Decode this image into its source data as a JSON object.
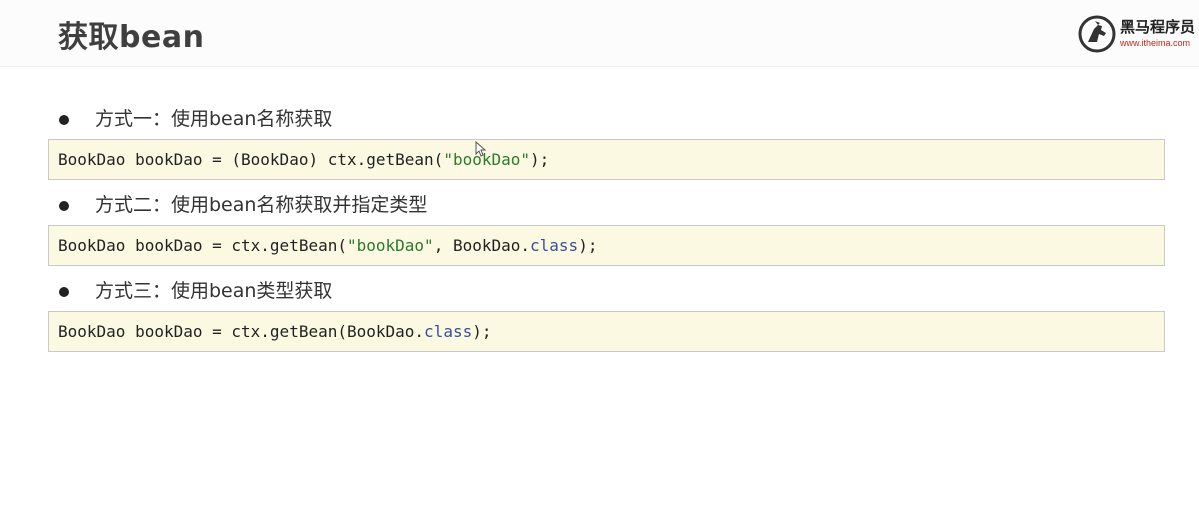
{
  "header": {
    "title": "获取bean",
    "logo_name": "黑马程序员",
    "logo_url": "www.itheima.com"
  },
  "methods": [
    {
      "label": "方式一：使用bean名称获取",
      "code": {
        "prefix": "BookDao bookDao = (BookDao) ctx.getBean(",
        "string": "\"bookDao\"",
        "middle": "",
        "keyword": "",
        "suffix": ");"
      }
    },
    {
      "label": "方式二：使用bean名称获取并指定类型",
      "code": {
        "prefix": "BookDao bookDao = ctx.getBean(",
        "string": "\"bookDao\"",
        "middle": ", BookDao.",
        "keyword": "class",
        "suffix": ");"
      }
    },
    {
      "label": "方式三：使用bean类型获取",
      "code": {
        "prefix": "BookDao bookDao = ctx.getBean(BookDao.",
        "string": "",
        "middle": "",
        "keyword": "class",
        "suffix": ");"
      }
    }
  ],
  "colors": {
    "code_background": "#fcf9e3",
    "string_literal": "#2c7a2c",
    "keyword": "#3a4ea0",
    "logo_accent": "#c0281f"
  }
}
